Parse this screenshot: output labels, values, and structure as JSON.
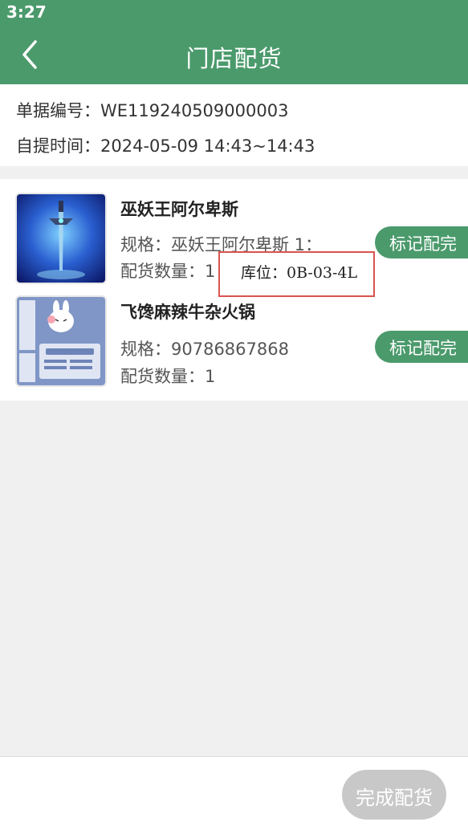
{
  "status_bar": {
    "time": "3:27"
  },
  "header": {
    "title": "门店配货"
  },
  "order": {
    "number_label": "单据编号：",
    "number_value": "WE119240509000003",
    "pickup_label": "自提时间：",
    "pickup_value": "2024-05-09 14:43~14:43"
  },
  "items": [
    {
      "name": "巫妖王阿尔卑斯",
      "spec_label": "规格：",
      "spec_value": "巫妖王阿尔卑斯 1：",
      "qty_label": "配货数量：",
      "qty_value": "1",
      "action_label": "标记配完",
      "thumb_icon": "frostmourne-sword-image"
    },
    {
      "name": "飞馋麻辣牛杂火锅",
      "spec_label": "规格：",
      "spec_value": "90786867868",
      "qty_label": "配货数量：",
      "qty_value": "1",
      "action_label": "标记配完",
      "thumb_icon": "bunny-sticker-image"
    }
  ],
  "tooltip": {
    "text": "库位：0B-03-4L"
  },
  "footer": {
    "complete_label": "完成配货"
  },
  "colors": {
    "primary": "#4b9a6c",
    "disabled": "#c8c8c8",
    "highlight_border": "#d9534f"
  }
}
